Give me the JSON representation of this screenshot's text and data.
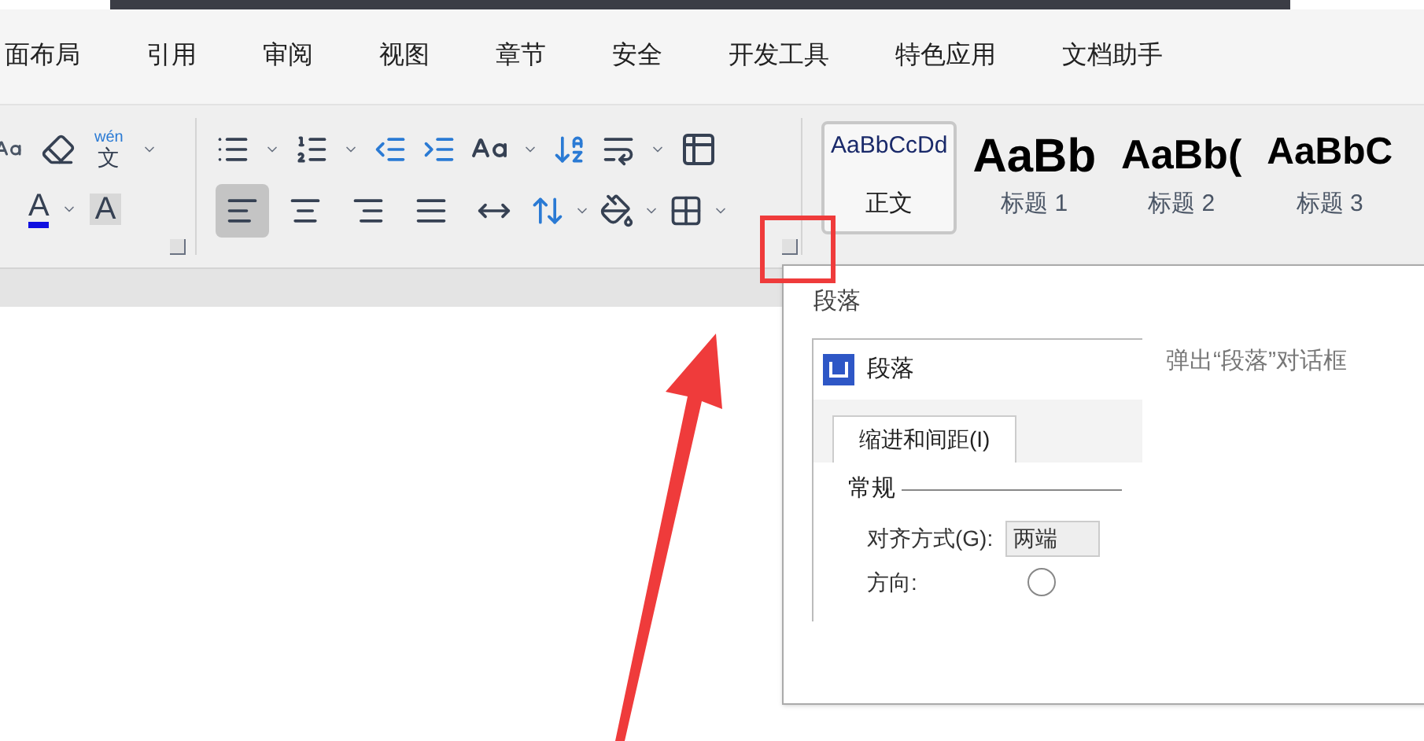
{
  "menu_tabs": [
    {
      "label": "面布局",
      "selected": false
    },
    {
      "label": "引用",
      "selected": false
    },
    {
      "label": "审阅",
      "selected": false
    },
    {
      "label": "视图",
      "selected": false
    },
    {
      "label": "章节",
      "selected": false
    },
    {
      "label": "安全",
      "selected": false
    },
    {
      "label": "开发工具",
      "selected": false
    },
    {
      "label": "特色应用",
      "selected": false
    },
    {
      "label": "文档助手",
      "selected": false
    }
  ],
  "font_group": {
    "phonetic_top": "wén",
    "phonetic_bottom": "文",
    "font_color_letter": "A",
    "shading_letter": "A"
  },
  "align_buttons": [
    {
      "selected": true
    },
    {
      "selected": false
    },
    {
      "selected": false
    },
    {
      "selected": false
    },
    {
      "selected": false
    }
  ],
  "styles": [
    {
      "preview": "AaBbCcDd",
      "label": "正文",
      "kind": "body",
      "selected": true
    },
    {
      "preview": "AaBb",
      "label": "标题 1",
      "kind": "h1",
      "selected": false
    },
    {
      "preview": "AaBb(",
      "label": "标题 2",
      "kind": "h2",
      "selected": false
    },
    {
      "preview": "AaBbC",
      "label": "标题 3",
      "kind": "h3",
      "selected": false
    }
  ],
  "tooltip": {
    "title": "段落",
    "description": "弹出“段落”对话框",
    "preview": {
      "dialog_title": "段落",
      "tab": "缩进和间距(I)",
      "section": "常规",
      "alignment_label": "对齐方式(G):",
      "alignment_value": "两端",
      "direction_label": "方向:",
      "direction_selected": false
    }
  }
}
